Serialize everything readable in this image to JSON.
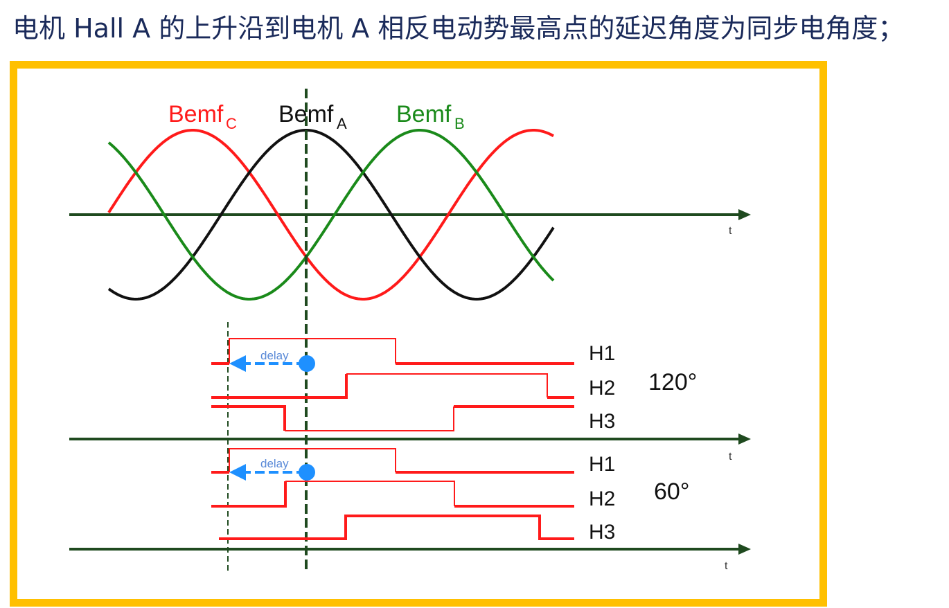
{
  "heading": "电机 Hall A 的上升沿到电机 A 相反电动势最高点的延迟角度为同步电角度；",
  "bemf": {
    "c": {
      "main": "Bemf",
      "sub": "C",
      "color": "#ff1a1a"
    },
    "a": {
      "main": "Bemf",
      "sub": "A",
      "color": "#111111"
    },
    "b": {
      "main": "Bemf",
      "sub": "B",
      "color": "#1a8a1a"
    }
  },
  "axis_label": "t",
  "delay_label": "delay",
  "panel_120": {
    "angle": "120°",
    "h1": "H1",
    "h2": "H2",
    "h3": "H3"
  },
  "panel_60": {
    "angle": "60°",
    "h1": "H1",
    "h2": "H2",
    "h3": "H3"
  },
  "colors": {
    "frame": "#ffc000",
    "axis": "#1f4a1f",
    "hall": "#ff1a1a",
    "delay": "#1e90ff"
  }
}
